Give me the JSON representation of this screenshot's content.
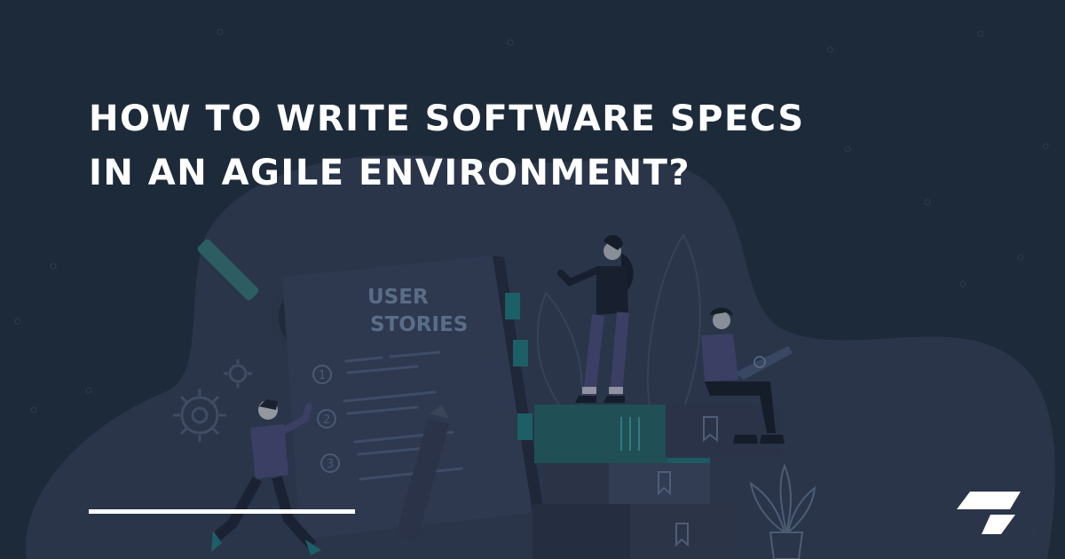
{
  "headline": {
    "line1": "HOW TO WRITE SOFTWARE SPECS",
    "line2": "IN AN AGILE ENVIRONMENT?"
  },
  "illustration": {
    "book_title_line1": "USER",
    "book_title_line2": "STORIES",
    "steps": [
      "1",
      "2",
      "3"
    ]
  },
  "colors": {
    "background": "#1d2a39",
    "blob": "#2a3549",
    "headline": "#ffffff",
    "accent_teal": "#1d5f66",
    "book": "#303a53"
  },
  "icons": [
    "checkmark-icon",
    "gear-icon",
    "bookmark-icon",
    "brand-logo-icon",
    "plant-icon"
  ]
}
